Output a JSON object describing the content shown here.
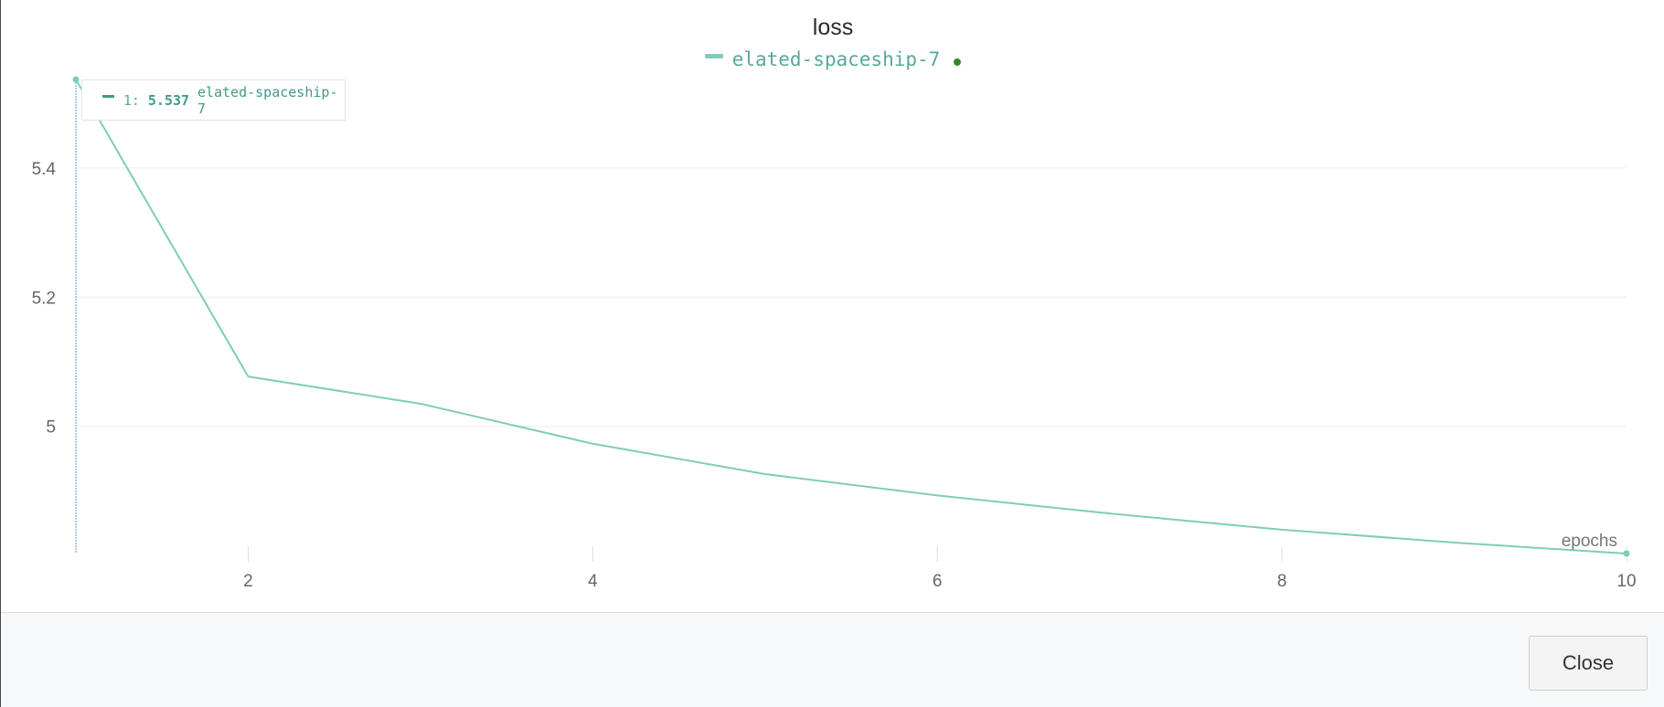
{
  "chart_data": {
    "type": "line",
    "title": "loss",
    "xlabel": "epochs",
    "ylabel": "",
    "xlim": [
      1,
      10
    ],
    "ylim": [
      4.803,
      5.537
    ],
    "x_ticks": [
      2,
      4,
      6,
      8,
      10
    ],
    "y_ticks": [
      5.0,
      5.2,
      5.4
    ],
    "y_tick_labels": [
      "5",
      "5.2",
      "5.4"
    ],
    "grid": true,
    "legend_position": "top-center",
    "series": [
      {
        "name": "elated-spaceship-7",
        "color": "#7fcdb8",
        "x": [
          1,
          2,
          3,
          4,
          5,
          6,
          7,
          8,
          9,
          10
        ],
        "values": [
          5.537,
          5.077,
          5.035,
          4.973,
          4.926,
          4.893,
          4.865,
          4.84,
          4.82,
          4.803
        ]
      }
    ]
  },
  "legend": {
    "run_name": "elated-spaceship-7",
    "swatch_color": "#7fcdb8",
    "text_color": "#5aa89a",
    "status_dot_color": "#2e8b2e"
  },
  "tooltip": {
    "step_prefix": "1:",
    "value": "5.537",
    "run_name": "elated-spaceship-7",
    "swatch_color": "#3a9a86",
    "text_color": "#3f9c88"
  },
  "footer": {
    "close_label": "Close"
  }
}
